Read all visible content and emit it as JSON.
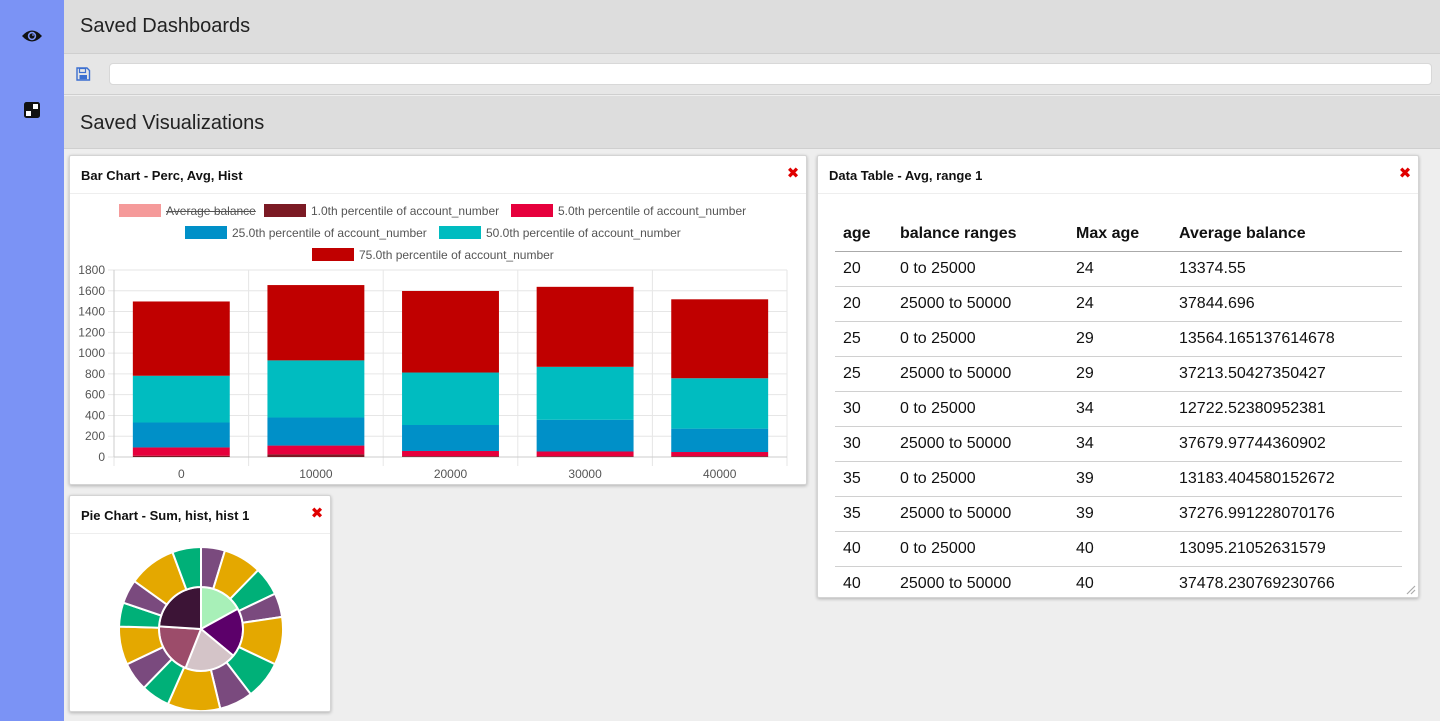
{
  "sidebar": {
    "items": [
      {
        "icon": "eye-icon"
      },
      {
        "icon": "dashboard-icon"
      }
    ]
  },
  "saved_dashboards": {
    "title": "Saved Dashboards",
    "save_icon": "floppy-disk-icon",
    "name_input": {
      "value": "",
      "placeholder": ""
    }
  },
  "saved_visualizations": {
    "title": "Saved Visualizations"
  },
  "panels": {
    "bar_chart": {
      "title": "Bar Chart - Perc, Avg, Hist",
      "close_icon": "close-x-icon"
    },
    "data_table": {
      "title": "Data Table - Avg, range 1",
      "close_icon": "close-x-icon"
    },
    "pie_chart": {
      "title": "Pie Chart - Sum, hist, hist 1",
      "close_icon": "close-x-icon"
    }
  },
  "colors": {
    "sidebar": "#7b93f5",
    "close": "#e00000",
    "avg_balance": "#f59a9a",
    "p1": "#7b1a24",
    "p5": "#e6003c",
    "p25": "#0090c8",
    "p50": "#00bcc0",
    "p75": "#c00000"
  },
  "data_table": {
    "columns": [
      "age",
      "balance ranges",
      "Max age",
      "Average balance"
    ],
    "rows": [
      [
        "20",
        "0 to 25000",
        "24",
        "13374.55"
      ],
      [
        "20",
        "25000 to 50000",
        "24",
        "37844.696"
      ],
      [
        "25",
        "0 to 25000",
        "29",
        "13564.165137614678"
      ],
      [
        "25",
        "25000 to 50000",
        "29",
        "37213.50427350427"
      ],
      [
        "30",
        "0 to 25000",
        "34",
        "12722.52380952381"
      ],
      [
        "30",
        "25000 to 50000",
        "34",
        "37679.97744360902"
      ],
      [
        "35",
        "0 to 25000",
        "39",
        "13183.404580152672"
      ],
      [
        "35",
        "25000 to 50000",
        "39",
        "37276.991228070176"
      ],
      [
        "40",
        "0 to 25000",
        "40",
        "13095.21052631579"
      ],
      [
        "40",
        "25000 to 50000",
        "40",
        "37478.230769230766"
      ]
    ]
  },
  "chart_data": [
    {
      "type": "bar",
      "stacked": true,
      "categories": [
        "0",
        "10000",
        "20000",
        "30000",
        "40000"
      ],
      "ylim": [
        0,
        1800
      ],
      "yticks": [
        0,
        200,
        400,
        600,
        800,
        1000,
        1200,
        1400,
        1600,
        1800
      ],
      "grid": true,
      "legend_position": "top",
      "series": [
        {
          "name": "Average balance",
          "hidden": true,
          "color": "#f59a9a",
          "values": [
            0,
            0,
            0,
            0,
            0
          ]
        },
        {
          "name": "1.0th percentile of account_number",
          "hidden": false,
          "color": "#7b1a24",
          "values": [
            12,
            25,
            8,
            8,
            8
          ]
        },
        {
          "name": "5.0th percentile of account_number",
          "hidden": false,
          "color": "#e6003c",
          "values": [
            80,
            85,
            50,
            45,
            40
          ]
        },
        {
          "name": "25.0th percentile of account_number",
          "hidden": false,
          "color": "#0090c8",
          "values": [
            240,
            270,
            250,
            305,
            225
          ]
        },
        {
          "name": "50.0th percentile of account_number",
          "hidden": false,
          "color": "#00bcc0",
          "values": [
            450,
            550,
            505,
            510,
            485
          ]
        },
        {
          "name": "75.0th percentile of account_number",
          "hidden": false,
          "color": "#c00000",
          "values": [
            715,
            725,
            785,
            770,
            760
          ]
        }
      ]
    },
    {
      "type": "pie",
      "rings": [
        {
          "ring": "inner",
          "slices": [
            {
              "value": 17,
              "color": "#a8f0b8"
            },
            {
              "value": 19,
              "color": "#5c006a"
            },
            {
              "value": 20,
              "color": "#d4c4c8"
            },
            {
              "value": 20,
              "color": "#9c4c6a"
            },
            {
              "value": 24,
              "color": "#3c1436"
            }
          ]
        },
        {
          "ring": "outer",
          "slices": [
            {
              "value": 5,
              "color": "#7a4a7e"
            },
            {
              "value": 8,
              "color": "#e4a800"
            },
            {
              "value": 6,
              "color": "#00b078"
            },
            {
              "value": 5,
              "color": "#7a4a7e"
            },
            {
              "value": 10,
              "color": "#e4a800"
            },
            {
              "value": 8,
              "color": "#00b078"
            },
            {
              "value": 7,
              "color": "#7a4a7e"
            },
            {
              "value": 11,
              "color": "#e4a800"
            },
            {
              "value": 6,
              "color": "#00b078"
            },
            {
              "value": 6,
              "color": "#7a4a7e"
            },
            {
              "value": 8,
              "color": "#e4a800"
            },
            {
              "value": 5,
              "color": "#00b078"
            },
            {
              "value": 5,
              "color": "#7a4a7e"
            },
            {
              "value": 10,
              "color": "#e4a800"
            },
            {
              "value": 6,
              "color": "#00b078"
            }
          ]
        }
      ]
    }
  ]
}
